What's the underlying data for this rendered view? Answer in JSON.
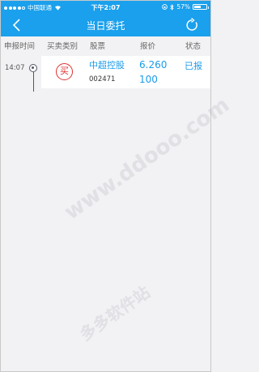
{
  "status_bar": {
    "carrier": "中国联通",
    "time": "下午2:07",
    "battery": "57%",
    "battery_level": 0.57
  },
  "nav": {
    "title": "当日委托"
  },
  "columns": {
    "time": "申报时间",
    "type": "买卖类别",
    "stock": "股票",
    "price": "报价",
    "status": "状态"
  },
  "orders": [
    {
      "time": "14:07",
      "type": "买",
      "name": "中超控股",
      "code": "002471",
      "price": "6.260",
      "quantity": "100",
      "status": "已报"
    }
  ],
  "watermarks": [
    "www.ddooo.com",
    "多多软件站"
  ],
  "colors": {
    "header": "#1aa0ec",
    "accent": "#1a9bea",
    "buy": "#e03030"
  }
}
